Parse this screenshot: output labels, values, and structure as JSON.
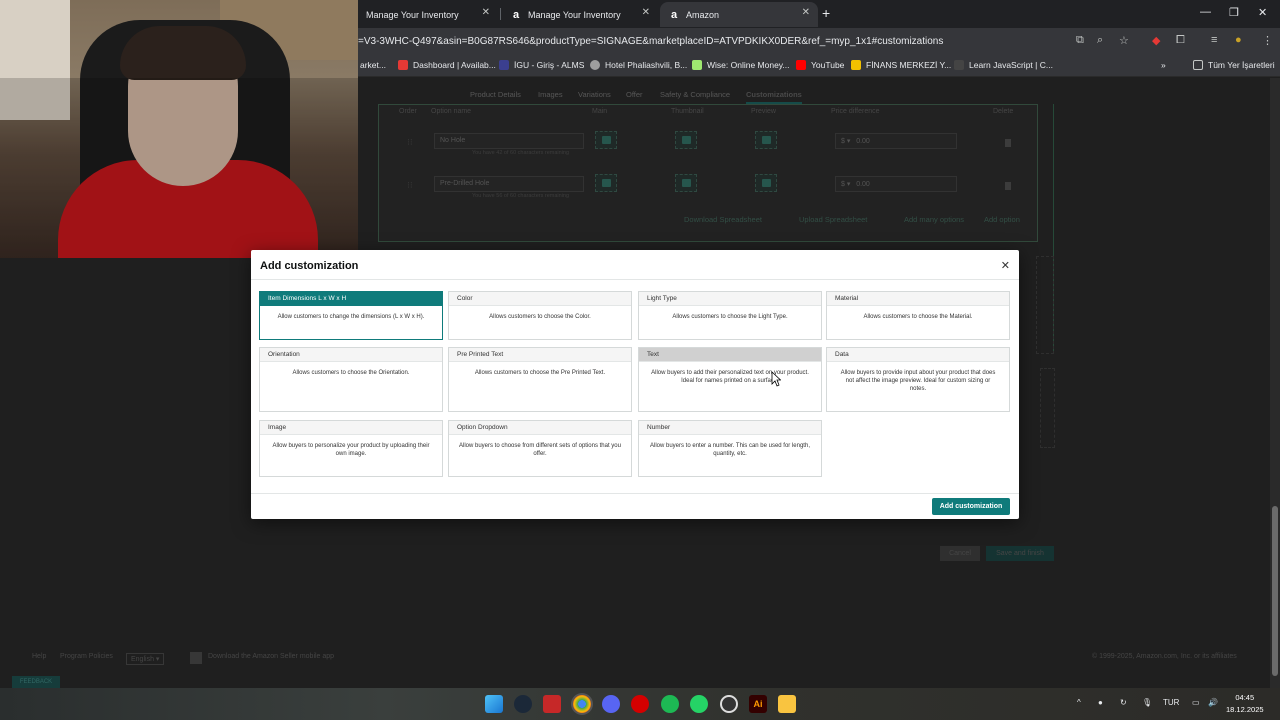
{
  "browser": {
    "tabs": [
      {
        "label": "Manage Your Inventory"
      },
      {
        "label": "Manage Your Inventory"
      },
      {
        "label": "Amazon"
      }
    ],
    "url": "=V3-3WHC-Q497&asin=B0G87RS646&productType=SIGNAGE&marketplaceID=ATVPDKIKX0DER&ref_=myp_1x1#customizations",
    "bookmarks": [
      {
        "label": "arket...",
        "color": "#e8eaed"
      },
      {
        "label": "Dashboard | Availab...",
        "color": "#e53935"
      },
      {
        "label": "İGU - Giriş - ALMS",
        "color": "#3b3f8f"
      },
      {
        "label": "Hotel Phaliashvili, B...",
        "color": "#9e9e9e"
      },
      {
        "label": "Wise: Online Money...",
        "color": "#9fe870"
      },
      {
        "label": "YouTube",
        "color": "#ff0000"
      },
      {
        "label": "FİNANS MERKEZİ Y...",
        "color": "#f2c100"
      },
      {
        "label": "Learn JavaScript | C...",
        "color": "#444444"
      }
    ],
    "bookmarks_folder": "Tüm Yer İşaretleri"
  },
  "page": {
    "tabs": [
      {
        "label": "Product Details"
      },
      {
        "label": "Images"
      },
      {
        "label": "Variations"
      },
      {
        "label": "Offer"
      },
      {
        "label": "Safety & Compliance"
      },
      {
        "label": "Customizations"
      }
    ],
    "columns": {
      "order": "Order",
      "option_name": "Option name",
      "main": "Main",
      "thumbnail": "Thumbnail",
      "preview": "Preview",
      "price_difference": "Price difference",
      "delete": "Delete"
    },
    "rows": [
      {
        "name": "No Hole",
        "hint": "You have 42 of 60 characters remaining",
        "currency": "$",
        "price": "0.00"
      },
      {
        "name": "Pre-Drilled Hole",
        "hint": "You have 56 of 60 characters remaining",
        "currency": "$",
        "price": "0.00"
      }
    ],
    "links": {
      "download": "Download Spreadsheet",
      "upload": "Upload Spreadsheet",
      "add_many": "Add many options",
      "add_option": "Add option"
    },
    "buttons": {
      "cancel": "Cancel",
      "save": "Save and finish"
    },
    "footer": {
      "help": "Help",
      "policies": "Program Policies",
      "language": "English",
      "app": "Download the Amazon Seller mobile app",
      "copyright": "© 1999-2025, Amazon.com, Inc. or its affiliates",
      "feedback": "FEEDBACK"
    }
  },
  "modal": {
    "title": "Add customization",
    "cards": [
      {
        "title": "Item Dimensions L x W x H",
        "desc": "Allow customers to change the dimensions (L x W x H).",
        "state": "selected"
      },
      {
        "title": "Color",
        "desc": "Allows customers to choose the Color.",
        "state": "normal"
      },
      {
        "title": "Light Type",
        "desc": "Allows customers to choose the Light Type.",
        "state": "normal"
      },
      {
        "title": "Material",
        "desc": "Allows customers to choose the Material.",
        "state": "normal"
      },
      {
        "title": "Orientation",
        "desc": "Allows customers to choose the Orientation.",
        "state": "normal"
      },
      {
        "title": "Pre Printed Text",
        "desc": "Allows customers to choose the Pre Printed Text.",
        "state": "normal"
      },
      {
        "title": "Text",
        "desc": "Allow buyers to add their personalized text on your product. Ideal for names printed on a surface.",
        "state": "hover"
      },
      {
        "title": "Data",
        "desc": "Allow buyers to provide input about your product that does not affect the image preview. Ideal for custom sizing or notes.",
        "state": "normal"
      },
      {
        "title": "Image",
        "desc": "Allow buyers to personalize your product by uploading their own image.",
        "state": "normal"
      },
      {
        "title": "Option Dropdown",
        "desc": "Allow buyers to choose from different sets of options that you offer.",
        "state": "normal"
      },
      {
        "title": "Number",
        "desc": "Allow buyers to enter a number. This can be used for length, quantity, etc.",
        "state": "normal"
      }
    ],
    "add_button": "Add customization",
    "accent": "#0f7b7b"
  },
  "taskbar": {
    "language": "TUR",
    "time": "04:45",
    "date": "18.12.2025"
  }
}
